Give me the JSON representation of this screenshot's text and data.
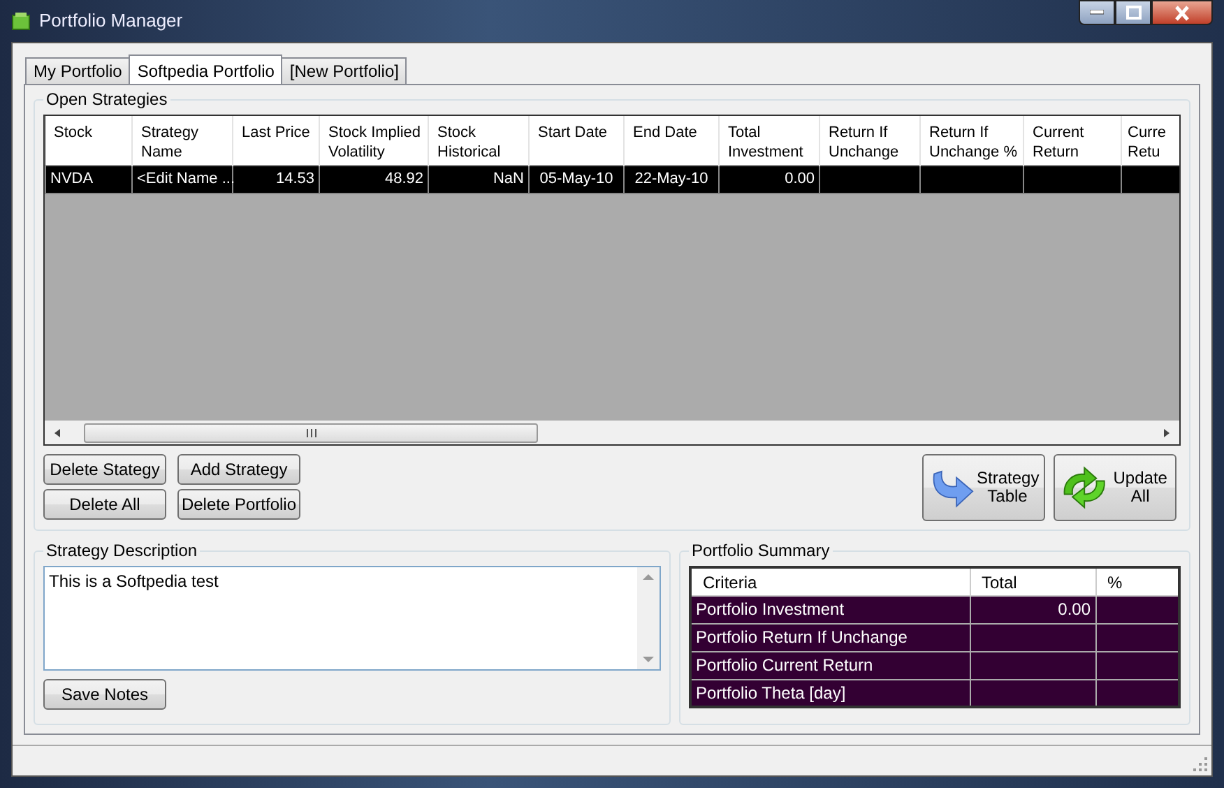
{
  "window": {
    "title": "Portfolio Manager"
  },
  "tabs": [
    {
      "label": "My Portfolio",
      "selected": false
    },
    {
      "label": "Softpedia Portfolio",
      "selected": true
    },
    {
      "label": "[New Portfolio]",
      "selected": false
    }
  ],
  "open_strategies": {
    "title": "Open Strategies",
    "columns": [
      {
        "label": "Stock",
        "kind": "text"
      },
      {
        "label": "Strategy Name",
        "kind": "text"
      },
      {
        "label": "Last Price",
        "kind": "number"
      },
      {
        "label": "Stock Implied Volatility",
        "kind": "number"
      },
      {
        "label": "Stock Historical",
        "kind": "number"
      },
      {
        "label": "Start Date",
        "kind": "date"
      },
      {
        "label": "End Date",
        "kind": "date"
      },
      {
        "label": "Total Investment",
        "kind": "number"
      },
      {
        "label": "Return If Unchange",
        "kind": "number"
      },
      {
        "label": "Return If Unchange %",
        "kind": "number"
      },
      {
        "label": "Current Return",
        "kind": "number"
      },
      {
        "label": "Curre Retu",
        "kind": "number"
      }
    ],
    "rows": [
      {
        "selected": true,
        "cells": [
          "NVDA",
          "<Edit Name ...",
          "14.53",
          "48.92",
          "NaN",
          "05-May-10",
          "22-May-10",
          "0.00"
        ]
      }
    ]
  },
  "strategy_buttons": [
    "Delete Stategy",
    "Add Strategy",
    "Delete All",
    "Delete Portfolio"
  ],
  "tool_buttons": [
    {
      "label": "Strategy Table",
      "kind": "arrow"
    },
    {
      "label": "Update All",
      "kind": "recycle"
    }
  ],
  "strategy_description": {
    "title": "Strategy Description",
    "value": "This is a Softpedia test",
    "button": "Save Notes"
  },
  "portfolio_summary": {
    "title": "Portfolio Summary",
    "columns": [
      "Criteria",
      "Total",
      "%"
    ],
    "rows": [
      {
        "cells": [
          "Portfolio Investment",
          "0.00"
        ]
      },
      {
        "cells": [
          "Portfolio Return If Unchange"
        ]
      },
      {
        "cells": [
          "Portfolio Current Return"
        ]
      },
      {
        "cells": [
          "Portfolio Theta [day]"
        ]
      }
    ]
  }
}
